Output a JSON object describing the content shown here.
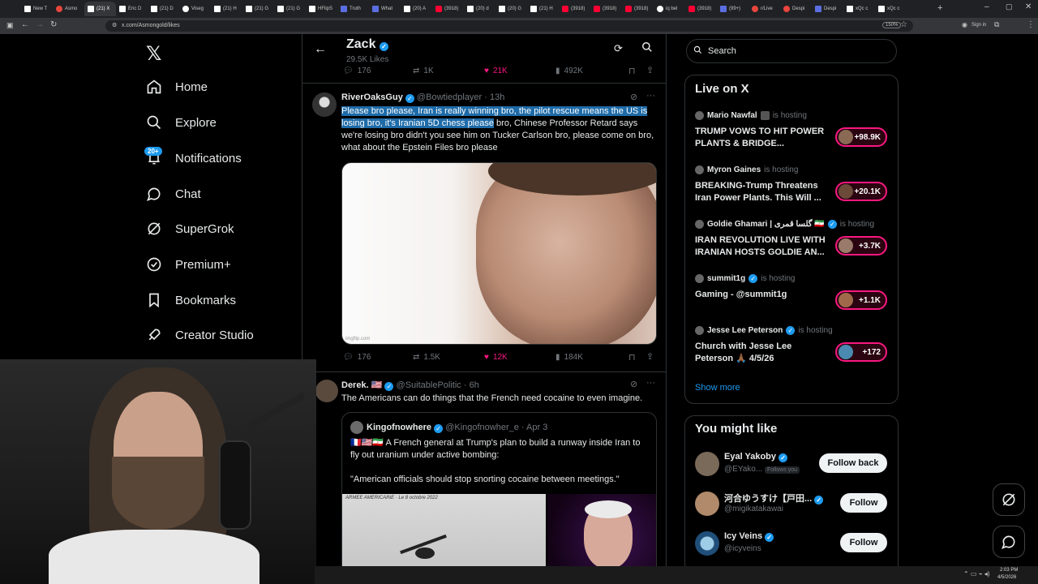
{
  "browser": {
    "tabs": [
      {
        "label": "New T",
        "icon": "x-icon"
      },
      {
        "label": "Asmo",
        "icon": "red-icon"
      },
      {
        "label": "(21) X",
        "icon": "x-icon",
        "active": true
      },
      {
        "label": "Eric D",
        "icon": "x-icon"
      },
      {
        "label": "(21) D",
        "icon": "x-icon"
      },
      {
        "label": "Viseg",
        "icon": "globe-icon"
      },
      {
        "label": "(21) H",
        "icon": "x-icon"
      },
      {
        "label": "(21) G",
        "icon": "x-icon"
      },
      {
        "label": "(21) G",
        "icon": "x-icon"
      },
      {
        "label": "HFlipS",
        "icon": "x-icon"
      },
      {
        "label": "Truth",
        "icon": "truth-icon"
      },
      {
        "label": "What",
        "icon": "t-icon"
      },
      {
        "label": "(20) A",
        "icon": "x-icon"
      },
      {
        "label": "(3918)",
        "icon": "yt-icon"
      },
      {
        "label": "(20) d",
        "icon": "x-icon"
      },
      {
        "label": "(20) G",
        "icon": "x-icon"
      },
      {
        "label": "(21) H",
        "icon": "x-icon"
      },
      {
        "label": "(3918)",
        "icon": "yt-icon"
      },
      {
        "label": "(3918)",
        "icon": "yt-icon"
      },
      {
        "label": "(3918)",
        "icon": "yt-icon"
      },
      {
        "label": "iq bel",
        "icon": "globe-icon"
      },
      {
        "label": "(3918)",
        "icon": "yt-icon"
      },
      {
        "label": "(99+)",
        "icon": "t-icon"
      },
      {
        "label": "r/Live",
        "icon": "red-icon"
      },
      {
        "label": "Despi",
        "icon": "red-icon"
      },
      {
        "label": "Despi",
        "icon": "t-icon"
      },
      {
        "label": "xQc c",
        "icon": "x-icon"
      },
      {
        "label": "xQc c",
        "icon": "x-icon"
      }
    ],
    "url": "x.com/Asmongold/likes",
    "zoom": "150%",
    "signin_label": "Sign in"
  },
  "sidebar": {
    "items": [
      {
        "label": "Home",
        "icon": "home-icon"
      },
      {
        "label": "Explore",
        "icon": "search-icon"
      },
      {
        "label": "Notifications",
        "icon": "bell-icon",
        "badge": "20+"
      },
      {
        "label": "Chat",
        "icon": "chat-icon"
      },
      {
        "label": "SuperGrok",
        "icon": "grok-icon"
      },
      {
        "label": "Premium+",
        "icon": "premium-icon"
      },
      {
        "label": "Bookmarks",
        "icon": "bookmark-icon"
      },
      {
        "label": "Creator Studio",
        "icon": "rocket-icon"
      }
    ]
  },
  "header": {
    "name": "Zack",
    "likes_count": "29.5K Likes"
  },
  "top_stats": {
    "replies": "176",
    "reposts": "1K",
    "likes": "21K",
    "views": "492K"
  },
  "tweet1": {
    "display_name": "RiverOaksGuy",
    "handle": "@Bowtiedplayer",
    "time": "· 13h",
    "text_highlighted": "Please bro please, Iran is really winning bro, the pilot rescue means the US is losing bro, it's Iranian 5D chess please",
    "text_rest": " bro, Chinese Professor Retard says we're losing bro didn't you see him on Tucker Carlson bro, please come on bro, what about the Epstein Files bro please",
    "media_caption": "imgflip.com",
    "stats": {
      "replies": "176",
      "reposts": "1.5K",
      "likes": "12K",
      "views": "184K"
    }
  },
  "tweet2": {
    "display_name": "Derek.",
    "flag": "🇺🇸",
    "handle": "@SuitablePolitic",
    "time": "· 6h",
    "text": "The Americans can do things that the French need cocaine to even imagine.",
    "quote": {
      "display_name": "Kingofnowhere",
      "handle": "@Kingofnowher_e",
      "time": "· Apr 3",
      "text1": "🇫🇷🇺🇸🇮🇷 A French general at Trump's plan to build a runway inside Iran to fly out uranium under active bombing:",
      "text2": "\"American officials should stop snorting cocaine between meetings.\"",
      "media_caption": "ARMEE AMERICAINE · Le 8 octobre 2022"
    }
  },
  "search": {
    "placeholder": "Search"
  },
  "live": {
    "title": "Live on X",
    "items": [
      {
        "host": "Mario Nawfal",
        "status": "is hosting",
        "title": "TRUMP VOWS TO HIT POWER PLANTS & BRIDGE...",
        "count": "+98.9K"
      },
      {
        "host": "Myron Gaines",
        "status": "is hosting",
        "title": "BREAKING-Trump Threatens Iran Power Plants. This Will ...",
        "count": "+20.1K"
      },
      {
        "host": "Goldie Ghamari | گلسا قمری 🇮🇷",
        "status": "is hosting",
        "title": "IRAN REVOLUTION LIVE WITH IRANIAN HOSTS GOLDIE AN...",
        "count": "+3.7K"
      },
      {
        "host": "summit1g",
        "status": "is hosting",
        "title": "Gaming - @summit1g",
        "count": "+1.1K"
      },
      {
        "host": "Jesse Lee Peterson",
        "status": "is hosting",
        "title": "Church with Jesse Lee Peterson 🙏🏾 4/5/26",
        "count": "+172"
      }
    ],
    "show_more": "Show more"
  },
  "wtf": {
    "title": "You might like",
    "items": [
      {
        "name": "Eyal Yakoby",
        "handle": "@EYako...",
        "extra": "Follows you",
        "button": "Follow back"
      },
      {
        "name": "河合ゆうすけ【戸田...",
        "handle": "@migikatakawai",
        "button": "Follow"
      },
      {
        "name": "Icy Veins",
        "handle": "@icyveins",
        "button": "Follow"
      }
    ]
  },
  "taskbar": {
    "time": "2:03 PM",
    "date": "4/5/2026"
  },
  "colors": {
    "accent": "#1d9bf0",
    "like": "#f91880",
    "bg": "#000000",
    "border": "#2f3336"
  }
}
